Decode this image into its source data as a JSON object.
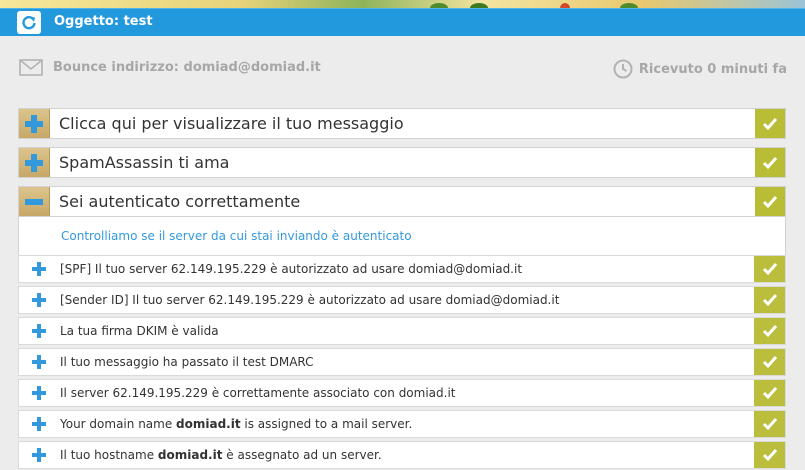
{
  "header": {
    "subject": "Oggetto: test"
  },
  "info": {
    "bounce": "Bounce indirizzo: domiad@domiad.it",
    "received": "Ricevuto 0 minuti fa"
  },
  "sections": [
    {
      "title": "Clicca qui per visualizzare il tuo messaggio",
      "state": "collapsed"
    },
    {
      "title": "SpamAssassin ti ama",
      "state": "collapsed"
    },
    {
      "title": "Sei autenticato correttamente",
      "state": "expanded"
    }
  ],
  "auth": {
    "intro": "Controlliamo se il server da cui stai inviando è autenticato",
    "items": [
      {
        "pre": "[SPF] Il tuo server 62.149.195.229 è autorizzato ad usare domiad@domiad.it",
        "bold": "",
        "post": ""
      },
      {
        "pre": "[Sender ID] Il tuo server 62.149.195.229 è autorizzato ad usare domiad@domiad.it",
        "bold": "",
        "post": ""
      },
      {
        "pre": "La tua firma DKIM è valida",
        "bold": "",
        "post": ""
      },
      {
        "pre": "Il tuo messaggio ha passato il test DMARC",
        "bold": "",
        "post": ""
      },
      {
        "pre": "Il server 62.149.195.229 è correttamente associato con domiad.it",
        "bold": "",
        "post": ""
      },
      {
        "pre": "Your domain name ",
        "bold": "domiad.it",
        "post": " is assigned to a mail server."
      },
      {
        "pre": "Il tuo hostname ",
        "bold": "domiad.it",
        "post": " è assegnato ad un server."
      }
    ]
  },
  "colors": {
    "header": "#2299dd",
    "check": "#b9bd36",
    "link": "#3399dd",
    "plus_icon": "#3399dd"
  },
  "icons": {
    "refresh": "refresh-icon",
    "mail": "envelope-icon",
    "clock": "clock-icon",
    "expand": "plus-icon",
    "collapse": "minus-icon",
    "pass": "check-icon"
  }
}
